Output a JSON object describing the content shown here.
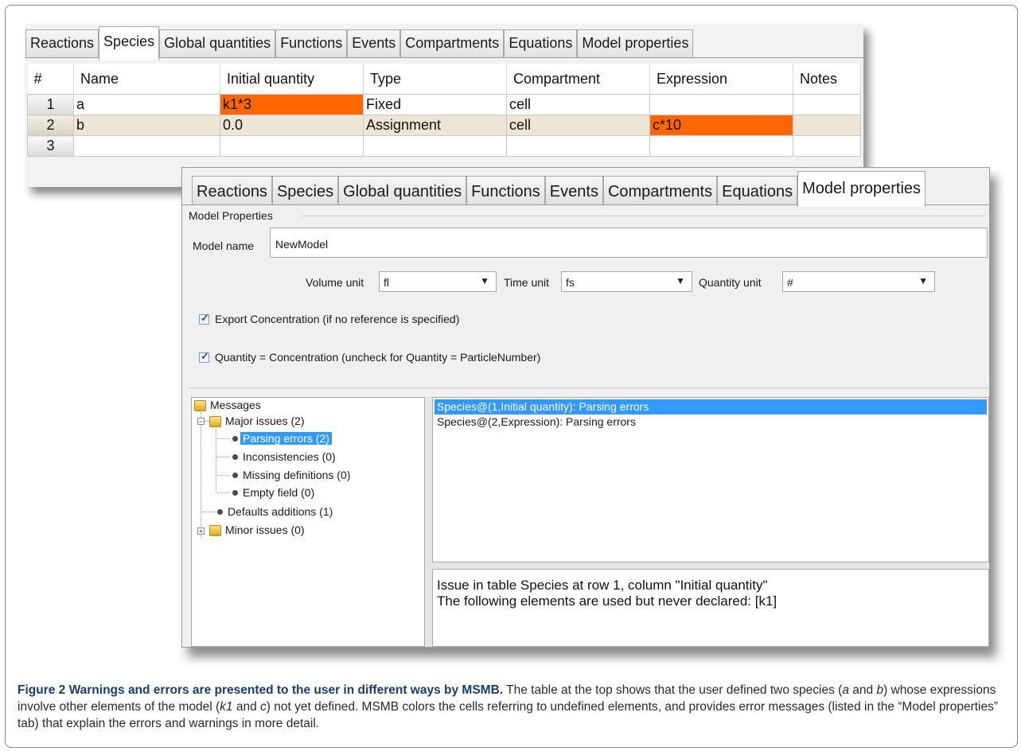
{
  "table_window": {
    "tabs": [
      "Reactions",
      "Species",
      "Global quantities",
      "Functions",
      "Events",
      "Compartments",
      "Equations",
      "Model properties"
    ],
    "active_tab": "Species",
    "columns": [
      "#",
      "Name",
      "Initial quantity",
      "Type",
      "Compartment",
      "Expression",
      "Notes"
    ],
    "rows": [
      {
        "num": "1",
        "name": "a",
        "initial_quantity": "k1*3",
        "type": "Fixed",
        "compartment": "cell",
        "expression": "",
        "notes": ""
      },
      {
        "num": "2",
        "name": "b",
        "initial_quantity": "0.0",
        "type": "Assignment",
        "compartment": "cell",
        "expression": "c*10",
        "notes": ""
      },
      {
        "num": "3",
        "name": "",
        "initial_quantity": "",
        "type": "",
        "compartment": "",
        "expression": "",
        "notes": ""
      }
    ]
  },
  "props_window": {
    "tabs": [
      "Reactions",
      "Species",
      "Global quantities",
      "Functions",
      "Events",
      "Compartments",
      "Equations",
      "Model properties"
    ],
    "active_tab": "Model properties",
    "group_title": "Model Properties",
    "model_name_label": "Model name",
    "model_name_value": "NewModel",
    "volume_unit_label": "Volume unit",
    "volume_unit_value": "fl",
    "time_unit_label": "Time unit",
    "time_unit_value": "fs",
    "quantity_unit_label": "Quantity unit",
    "quantity_unit_value": "#",
    "export_concentration_label": "Export Concentration (if no reference is specified)",
    "export_concentration_checked": true,
    "quantity_concentration_label": "Quantity = Concentration (uncheck for Quantity = ParticleNumber)",
    "quantity_concentration_checked": true
  },
  "messages_tree": {
    "root": "Messages",
    "major": "Major issues (2)",
    "parsing": "Parsing errors (2)",
    "inconsistencies": "Inconsistencies (0)",
    "missing": "Missing definitions (0)",
    "empty": "Empty field (0)",
    "defaults": "Defaults additions (1)",
    "minor": "Minor issues (0)"
  },
  "message_list": [
    "Species@(1,Initial quantity): Parsing errors",
    "Species@(2,Expression): Parsing errors"
  ],
  "detail_lines": [
    "Issue in table Species at row 1, column \"Initial quantity\"",
    "The following elements are used but never declared: [k1]"
  ],
  "colors": {
    "error_cell": "#ff6600",
    "selection": "#3399ff",
    "selected_row": "#ede6d6",
    "caption_title": "#1a3c6e"
  },
  "caption": {
    "title": "Figure 2 Warnings and errors are presented to the user in different ways by MSMB.",
    "p1": " The table at the top shows that the user defined two species (",
    "a": "a",
    "p2": " and ",
    "b": "b",
    "p3": ") whose expressions involve other elements of the model (",
    "k1": "k1",
    "p4": " and ",
    "c": "c",
    "p5": ") not yet defined. MSMB colors the cells referring to undefined elements, and provides error messages (listed in the “Model properties” tab) that explain the errors and warnings in more detail."
  }
}
